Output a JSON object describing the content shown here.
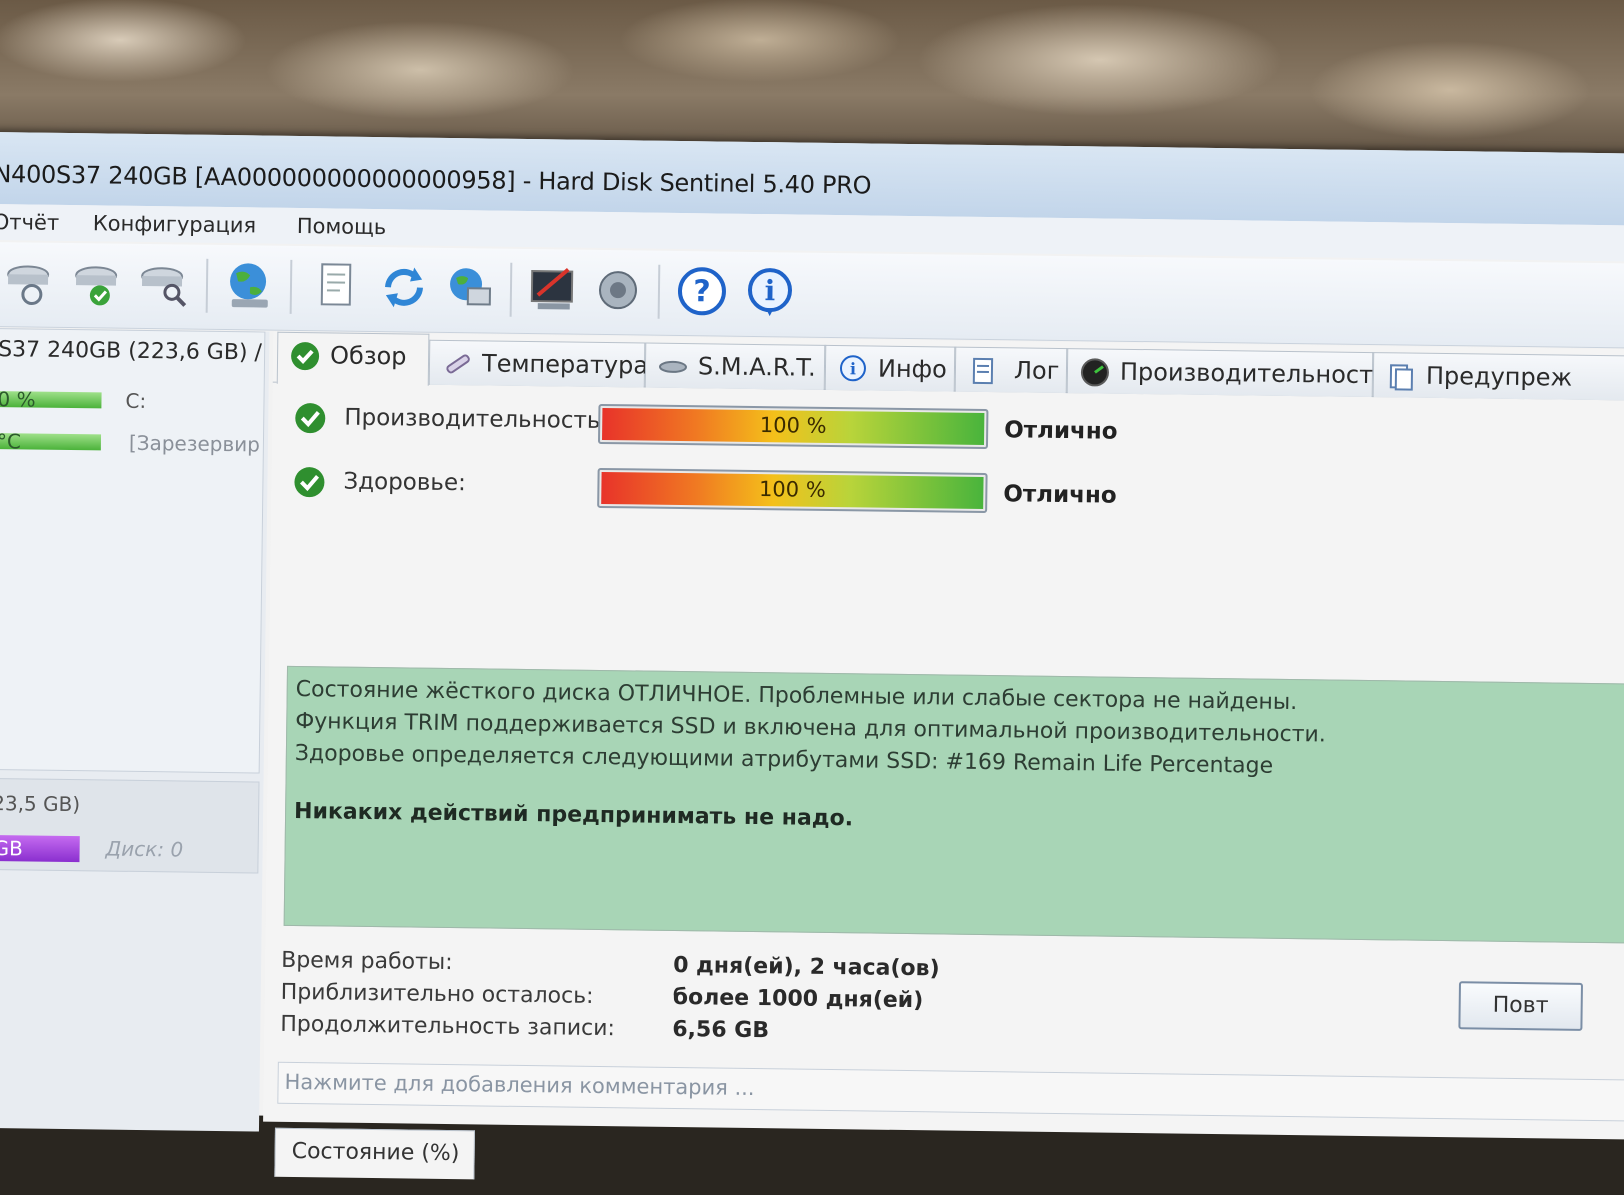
{
  "window": {
    "title": "N400S37 240GB [AA000000000000000958]  -  Hard Disk Sentinel 5.40 PRO"
  },
  "menu": {
    "items": [
      "Отчёт",
      "Конфигурация",
      "Помощь"
    ]
  },
  "toolbar": {
    "icons": [
      "disk-refresh-icon",
      "disk-check-icon",
      "disk-search-icon",
      "globe-icon",
      "report-icon",
      "refresh-icon",
      "network-icon",
      "settings-icon",
      "sound-icon",
      "help-icon",
      "info-icon"
    ]
  },
  "sidebar": {
    "disk_title": "S37 240GB (223,6 GB) /",
    "health_pct": "0 %",
    "drive_letter": "C:",
    "temp": "°C",
    "reserved_label": "[Зарезервир",
    "volume_size": "23,5 GB)",
    "volume_bar": "GB",
    "disk_label": "Диск: 0"
  },
  "tabs": [
    {
      "label": "Обзор",
      "icon": "check-icon"
    },
    {
      "label": "Температура",
      "icon": "thermometer-icon"
    },
    {
      "label": "S.M.A.R.T.",
      "icon": "smart-icon"
    },
    {
      "label": "Инфо",
      "icon": "info-icon"
    },
    {
      "label": "Лог",
      "icon": "log-icon"
    },
    {
      "label": "Производительность",
      "icon": "gauge-icon"
    },
    {
      "label": "Предупреж",
      "icon": "document-icon"
    }
  ],
  "overview": {
    "performance_label": "Производительность:",
    "performance_value": "100 %",
    "performance_pct": 100,
    "performance_rating": "Отлично",
    "health_label": "Здоровье:",
    "health_value": "100 %",
    "health_pct": 100,
    "health_rating": "Отлично",
    "status_lines": [
      "Состояние жёсткого диска ОТЛИЧНОЕ. Проблемные или слабые сектора не найдены.",
      "Функция TRIM поддерживается SSD и включена для оптимальной производительности.",
      "Здоровье определяется следующими атрибутами SSD: #169 Remain Life Percentage"
    ],
    "status_action": "Никаких действий предпринимать не надо.",
    "uptime_label": "Время работы:",
    "uptime_value": "0 дня(ей), 2 часа(ов)",
    "remaining_label": "Приблизительно осталось:",
    "remaining_value": "более 1000 дня(ей)",
    "written_label": "Продолжительность записи:",
    "written_value": "6,56 GB",
    "repeat_button": "Повт",
    "comment_placeholder": "Нажмите для добавления комментария ...",
    "bottom_tab": "Состояние (%)"
  },
  "colors": {
    "status_bg": "#a8d5b6",
    "title_bg": "#c2d5ea",
    "check_green": "#2f8f2f"
  }
}
